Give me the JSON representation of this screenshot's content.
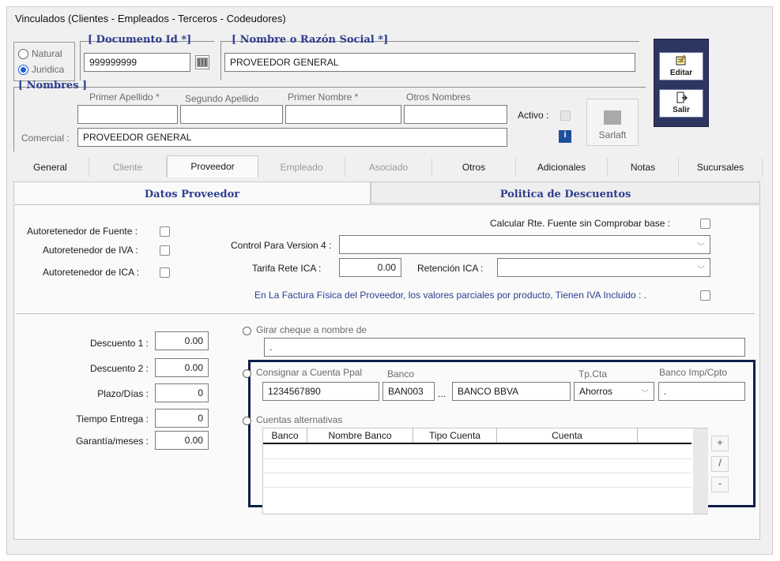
{
  "window": {
    "title": "Vinculados   (Clientes - Empleados - Terceros - Codeudores)"
  },
  "person_type": {
    "natural_label": "Natural",
    "juridica_label": "Juridica",
    "selected": "Juridica"
  },
  "documento": {
    "group_label": "[ Documento Id *]",
    "value": "999999999"
  },
  "razon_social": {
    "group_label": "[ Nombre o Razón Social *]",
    "value": "PROVEEDOR GENERAL"
  },
  "nombres": {
    "group_label": "[ Nombres ]",
    "primer_apellido_label": "Primer Apellido *",
    "segundo_apellido_label": "Segundo Apellido",
    "primer_nombre_label": "Primer Nombre *",
    "otros_nombres_label": "Otros Nombres",
    "primer_apellido": "",
    "segundo_apellido": "",
    "primer_nombre": "",
    "otros_nombres": "",
    "comercial_label": "Comercial :",
    "comercial": "PROVEEDOR GENERAL"
  },
  "activo": {
    "label": "Activo :",
    "info": "i"
  },
  "sarlaft": {
    "label": "Sarlaft"
  },
  "toolbar": {
    "editar": "Editar",
    "salir": "Salir"
  },
  "tabs": [
    {
      "label": "General",
      "state": "normal"
    },
    {
      "label": "Cliente",
      "state": "disabled"
    },
    {
      "label": "Proveedor",
      "state": "active"
    },
    {
      "label": "Empleado",
      "state": "disabled"
    },
    {
      "label": "Asociado",
      "state": "disabled"
    },
    {
      "label": "Otros",
      "state": "normal"
    },
    {
      "label": "Adicionales",
      "state": "normal"
    },
    {
      "label": "Notas",
      "state": "normal"
    },
    {
      "label": "Sucursales",
      "state": "normal"
    }
  ],
  "subtabs": {
    "datos": "Datos Proveedor",
    "politica": "Politica de Descuentos"
  },
  "retenciones": {
    "autoret_fuente": "Autoretenedor de Fuente :",
    "autoret_iva": "Autoretenedor de IVA :",
    "autoret_ica": "Autoretenedor de ICA :",
    "calcular_rte": "Calcular Rte. Fuente sin Comprobar base :",
    "control_version": "Control Para Version 4 :",
    "tarifa_rete_ica_label": "Tarifa Rete ICA :",
    "tarifa_rete_ica": "0.00",
    "retencion_ica_label": "Retención ICA :",
    "factura_iva": "En La Factura Física del Proveedor, los valores parciales  por producto, Tienen IVA Incluido : ."
  },
  "descuentos": {
    "descuento1_label": "Descuento 1 :",
    "descuento1": "0.00",
    "descuento2_label": "Descuento 2 :",
    "descuento2": "0.00",
    "plazo_label": "Plazo/Días :",
    "plazo": "0",
    "tiempo_label": "Tiempo Entrega :",
    "tiempo": "0",
    "garantia_label": "Garantía/meses :",
    "garantia": "0.00"
  },
  "pago": {
    "girar_label": "Girar cheque a nombre de",
    "girar_value": ".",
    "consignar_label": "Consignar a Cuenta Ppal",
    "banco_label": "Banco",
    "tpcta_label": "Tp.Cta",
    "banco_imp_label": "Banco Imp/Cpto",
    "cuenta": "1234567890",
    "banco_code": "BAN003",
    "ellipsis": "...",
    "banco_name": "BANCO BBVA",
    "tipo_cuenta": "Ahorros",
    "banco_imp": ".",
    "alternativas_label": "Cuentas alternativas",
    "grid_headers": [
      "Banco",
      "Nombre Banco",
      "Tipo Cuenta",
      "Cuenta"
    ],
    "btn_add": "+",
    "btn_edit": "/",
    "btn_remove": "-"
  },
  "colors": {
    "accent": "#2d3e8f",
    "highlight_border": "#0f1f4a",
    "radio_on": "#1d5ed8"
  }
}
